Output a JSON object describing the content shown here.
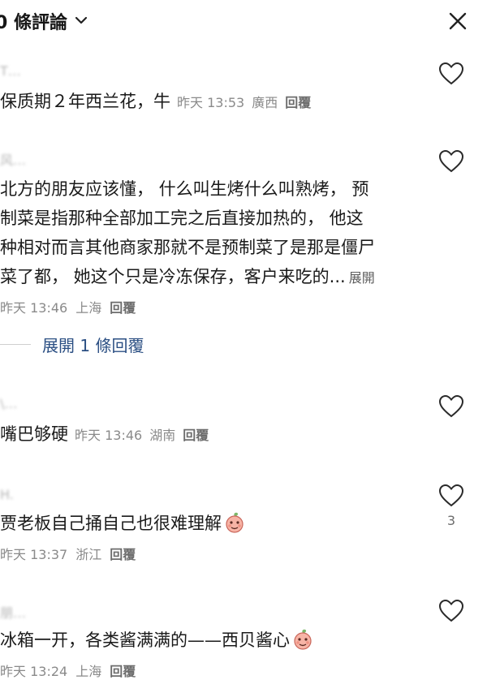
{
  "header": {
    "title": "0 條評論"
  },
  "comments": [
    {
      "username": "T…",
      "text": "保质期２年西兰花，牛",
      "time": "昨天 13:53",
      "location": "廣西",
      "reply": "回覆"
    },
    {
      "username": "风…",
      "lines": [
        "北方的朋友应该懂， 什么叫生烤什么叫熟烤， 预",
        "制菜是指那种全部加工完之后直接加热的， 他这",
        "种相对而言其他商家那就不是预制菜了是那是僵尸",
        "菜了都， 她这个只是冷冻保存，客户来吃的..."
      ],
      "expand": "展開",
      "time": "昨天 13:46",
      "location": "上海",
      "reply": "回覆",
      "replies_toggle": "展開 1 條回覆"
    },
    {
      "username": "\\…",
      "text": "嘴巴够硬",
      "time": "昨天 13:46",
      "location": "湖南",
      "reply": "回覆"
    },
    {
      "username": "H.",
      "text": "贾老板自己捅自己也很难理解",
      "time": "昨天 13:37",
      "location": "浙江",
      "reply": "回覆",
      "likes": "3"
    },
    {
      "username": "朋…",
      "text": "冰箱一开，各类酱满满的——西贝酱心",
      "time": "昨天 13:24",
      "location": "上海",
      "reply": "回覆"
    }
  ],
  "icons": {
    "heart": "heart-outline-icon",
    "close": "close-icon",
    "chevron": "chevron-down-icon",
    "emoji": "peach-emoji-icon"
  },
  "colors": {
    "text": "#1a1a1a",
    "meta": "#8a8a8a",
    "link": "#2b4f83",
    "emoji": "#ee8a7a"
  }
}
